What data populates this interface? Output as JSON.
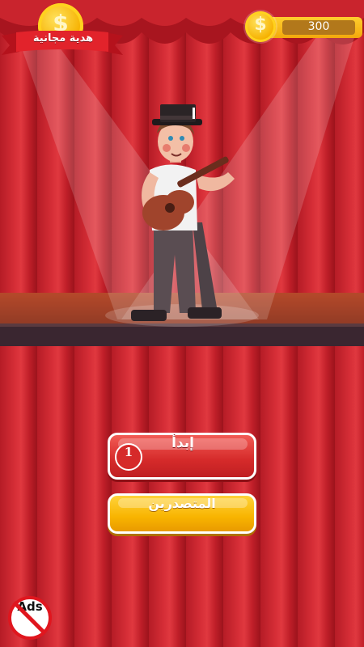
{
  "gift": {
    "label": "هدية مجانية",
    "icon": "gold-coin-dollar-icon",
    "coin_symbol": "$"
  },
  "coins": {
    "value": "300",
    "icon": "gold-coin-dollar-icon",
    "coin_symbol": "$"
  },
  "start_button": {
    "label": "إبدأ",
    "level": "1",
    "color": "#d52a2a"
  },
  "leaderboard_button": {
    "label": "المتصدرين",
    "color": "#f8b400"
  },
  "no_ads": {
    "label": "Ads",
    "icon": "no-ads-icon"
  },
  "theme": {
    "curtain": "#c0222c",
    "stage": "#a5432a",
    "gold": "#f6b100"
  }
}
